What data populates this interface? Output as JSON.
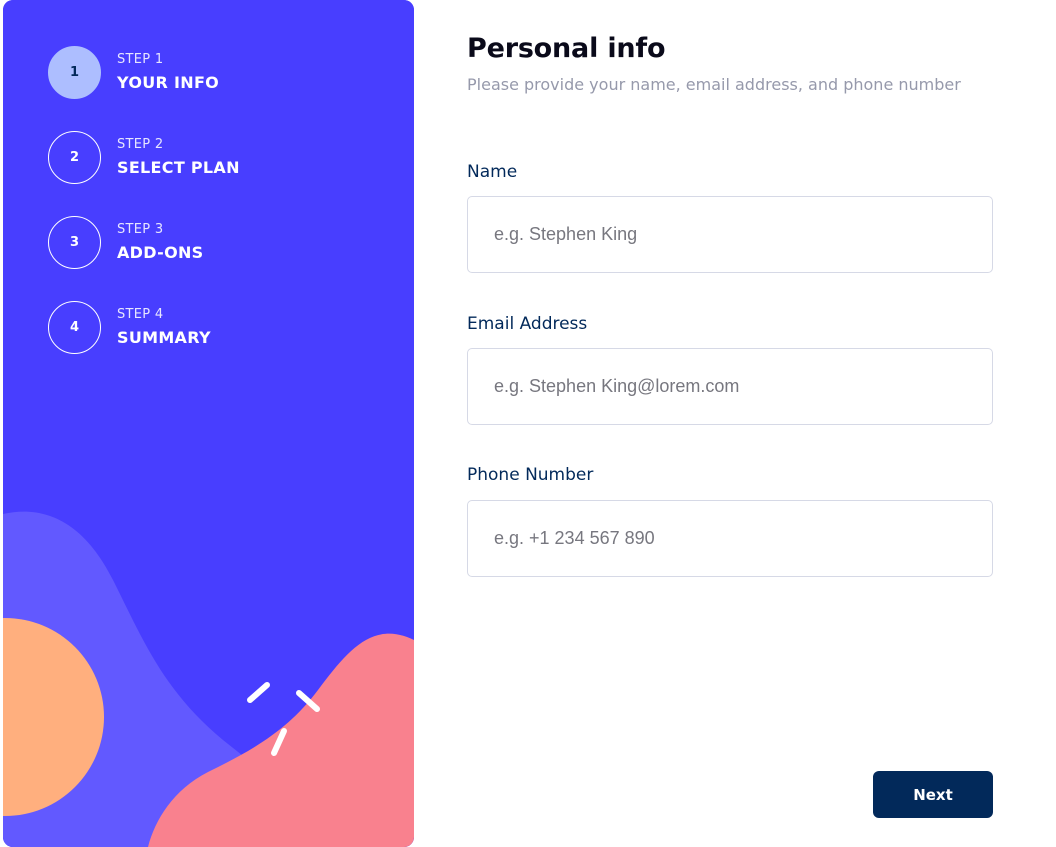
{
  "sidebar": {
    "steps": [
      {
        "number": "1",
        "label": "STEP 1",
        "title": "YOUR INFO",
        "active": true
      },
      {
        "number": "2",
        "label": "STEP 2",
        "title": "SELECT PLAN",
        "active": false
      },
      {
        "number": "3",
        "label": "STEP 3",
        "title": "ADD-ONS",
        "active": false
      },
      {
        "number": "4",
        "label": "STEP 4",
        "title": "SUMMARY",
        "active": false
      }
    ],
    "colors": {
      "background": "#483eff",
      "wave": "#6259ff",
      "circle": "#ffaf7e",
      "blob": "#f9818e",
      "active_step": "#adbeff"
    }
  },
  "form": {
    "title": "Personal info",
    "subtitle": "Please provide your name, email address, and phone number",
    "fields": {
      "name": {
        "label": "Name",
        "placeholder": "e.g. Stephen King",
        "value": ""
      },
      "email": {
        "label": "Email Address",
        "placeholder": "e.g. Stephen King@lorem.com",
        "value": ""
      },
      "phone": {
        "label": "Phone Number",
        "placeholder": "e.g. +1 234 567 890",
        "value": ""
      }
    },
    "next_label": "Next"
  },
  "colors": {
    "primary": "#02295a",
    "border": "#d6d9e6",
    "muted_text": "#9699ab"
  }
}
